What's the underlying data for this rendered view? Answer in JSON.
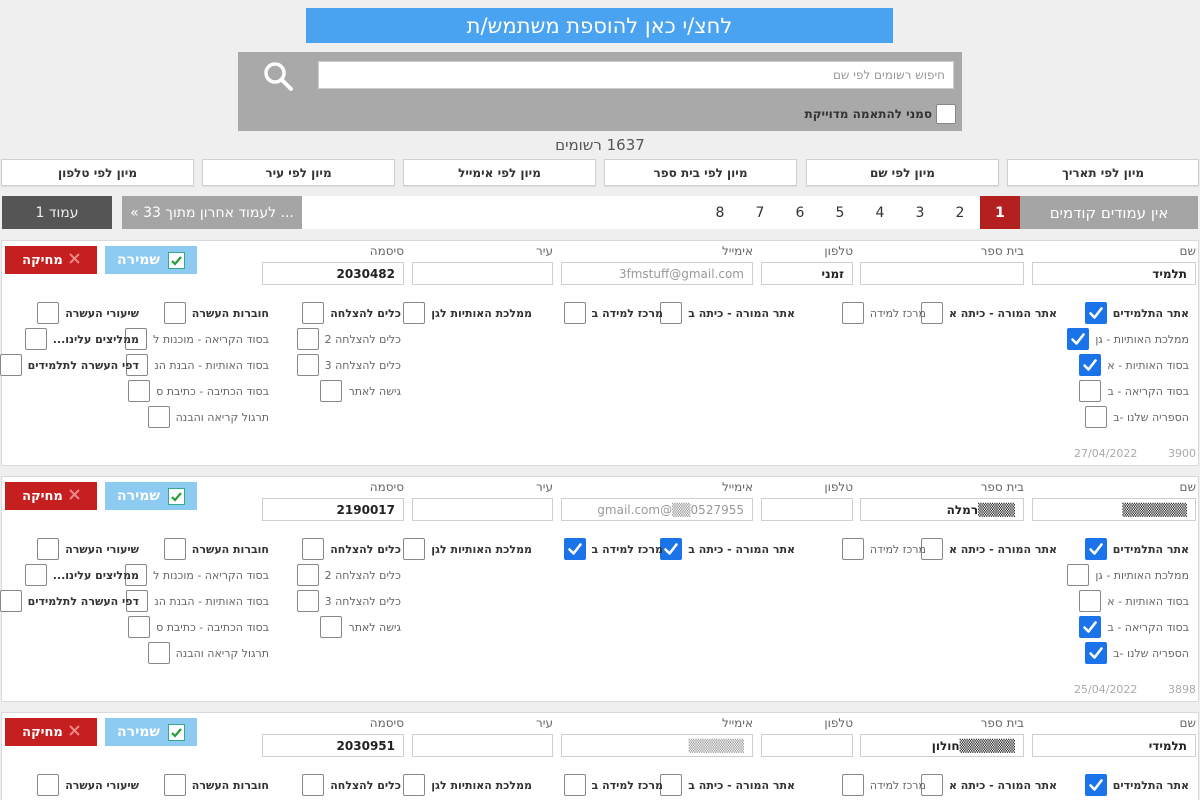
{
  "header": {
    "add_user_label": "לחצ/י כאן להוספת משתמש/ת"
  },
  "search": {
    "placeholder": "חיפוש רשומים לפי שם",
    "exact_match_label": "סמני להתאמה מדוייקת"
  },
  "records_count": "1637 רשומים",
  "sort_buttons": [
    "מיון לפי תאריך",
    "מיון לפי שם",
    "מיון לפי בית ספר",
    "מיון לפי אימייל",
    "מיון לפי עיר",
    "מיון לפי טלפון"
  ],
  "pagination": {
    "no_prev_label": "אין עמודים קודמים",
    "pages": [
      "1",
      "2",
      "3",
      "4",
      "5",
      "6",
      "7",
      "8"
    ],
    "current_page": "1",
    "last_page_label": "... לעמוד אחרון מתוך 33 »",
    "page_indicator": "עמוד 1"
  },
  "labels": {
    "name": "שם",
    "school": "בית ספר",
    "phone": "טלפון",
    "email": "אימייל",
    "city": "עיר",
    "password": "סיסמה",
    "save": "שמירה",
    "delete": "מחיקה"
  },
  "permissions": {
    "col1": [
      "אתר התלמידים",
      "ממלכת האותיות - גן",
      "בסוד האותיות - א",
      "בסוד הקריאה - ב",
      "הספריה שלנו -ב"
    ],
    "col2": [
      "אתר המורה - כיתה א"
    ],
    "col3": [
      "מרכז למידה"
    ],
    "col4": [
      "אתר המורה - כיתה ב"
    ],
    "col5": [
      "מרכז למידה ב"
    ],
    "col6": [
      "ממלכת האותיות לגן"
    ],
    "col7": [
      "כלים להצלחה",
      "כלים להצלחה 2",
      "כלים להצלחה 3",
      "גישה לאתר"
    ],
    "col8": [
      "חוברות העשרה",
      "בסוד הקריאה - מוכנות ל",
      "בסוד האותיות - הבנת הנ",
      "בסוד הכתיבה - כתיבת ס",
      "תרגול קריאה והבנה"
    ],
    "col9": [
      "שיעורי העשרה",
      "ממליצים עלינו...",
      "דפי העשרה לתלמידים"
    ]
  },
  "records": [
    {
      "name": "תלמיד",
      "school": "",
      "phone": "זמני",
      "email": "3fmstuff@gmail.com",
      "city": "",
      "password": "2030482",
      "date": "27/04/2022",
      "id": "3900",
      "checks": {
        "col1": [
          true,
          true,
          true,
          false,
          false
        ],
        "col2": [
          false
        ],
        "col3": [
          false
        ],
        "col4": [
          false
        ],
        "col5": [
          false
        ],
        "col6": [
          false
        ],
        "col7": [
          false,
          false,
          false,
          false
        ],
        "col8": [
          false,
          false,
          false,
          false,
          false
        ],
        "col9": [
          false,
          false,
          false
        ]
      }
    },
    {
      "name": "▒▒▒▒▒▒▒",
      "school": "▒▒▒▒רמלה",
      "phone": "",
      "email": "0527955▒▒@gmail.com",
      "city": "",
      "password": "2190017",
      "date": "25/04/2022",
      "id": "3898",
      "checks": {
        "col1": [
          true,
          false,
          false,
          true,
          true
        ],
        "col2": [
          false
        ],
        "col3": [
          false
        ],
        "col4": [
          true
        ],
        "col5": [
          true
        ],
        "col6": [
          false
        ],
        "col7": [
          false,
          false,
          false,
          false
        ],
        "col8": [
          false,
          false,
          false,
          false,
          false
        ],
        "col9": [
          false,
          false,
          false
        ]
      }
    },
    {
      "name": "תלמידי",
      "school": "▒▒▒▒▒▒חולון",
      "phone": "",
      "email": "▒▒▒▒▒▒",
      "city": "",
      "password": "2030951",
      "checks": {
        "col1": [
          true
        ],
        "col2": [
          false
        ],
        "col3": [
          false
        ],
        "col4": [
          false
        ],
        "col5": [
          false
        ],
        "col6": [
          false
        ],
        "col7": [
          false
        ],
        "col8": [
          false
        ],
        "col9": [
          false
        ]
      }
    }
  ],
  "colors": {
    "accent": "#4aa3f0",
    "current_page": "#b41f1f",
    "delete": "#c51f1f",
    "checkbox_on": "#1a73e8"
  }
}
